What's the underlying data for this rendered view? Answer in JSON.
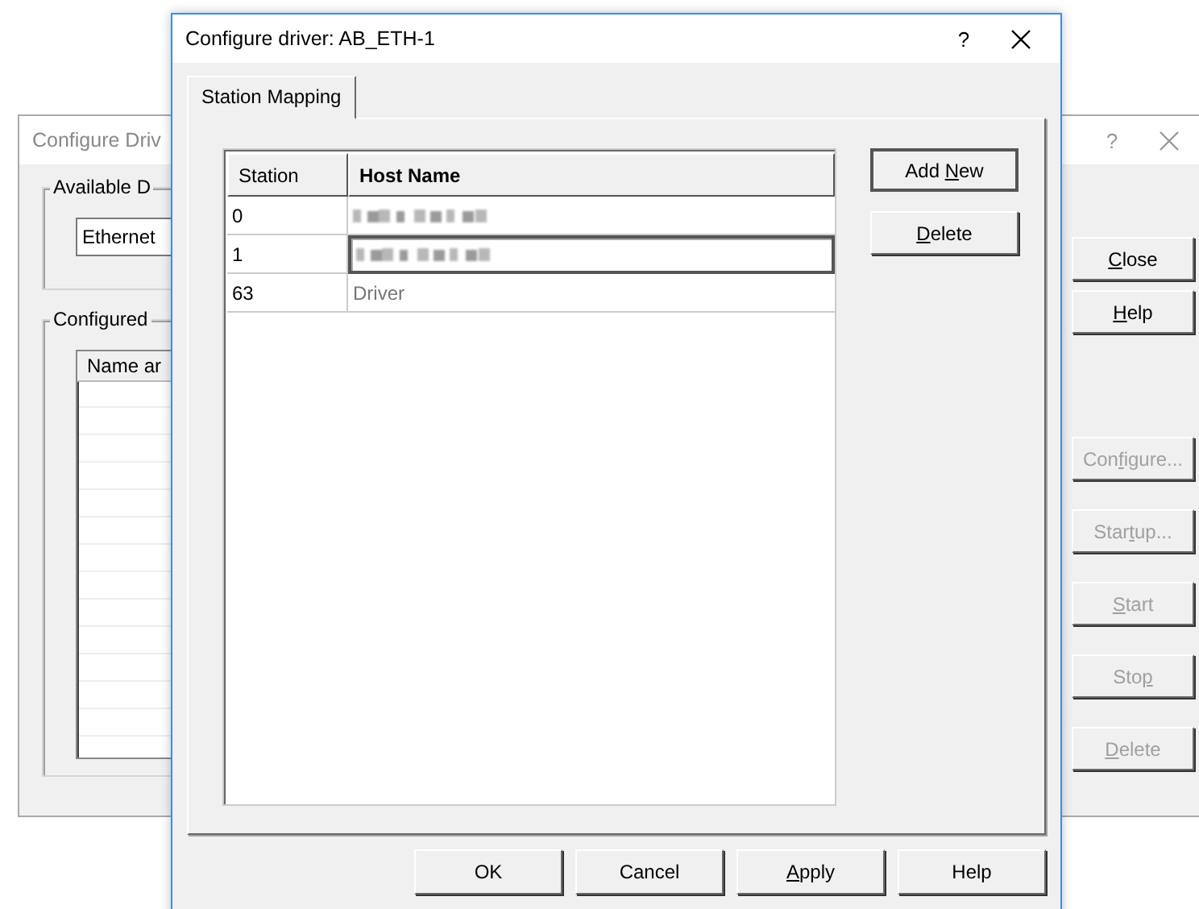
{
  "back_window": {
    "title": "Configure Driv",
    "active": false,
    "available_group": {
      "label": "Available D",
      "field_value": "Ethernet"
    },
    "configured_group": {
      "label": "Configured ",
      "column_header": "Name ar"
    },
    "buttons": [
      {
        "label": {
          "key": "C",
          "after": "lose"
        },
        "disabled": false
      },
      {
        "label": {
          "key": "H",
          "after": "elp"
        },
        "disabled": false
      },
      {
        "label": {
          "before": "Con",
          "key": "f",
          "after": "igure..."
        },
        "disabled": true
      },
      {
        "label": {
          "before": "Star",
          "key": "t",
          "after": "up..."
        },
        "disabled": true
      },
      {
        "label": {
          "key": "S",
          "after": "tart"
        },
        "disabled": true
      },
      {
        "label": {
          "before": "Sto",
          "key": "p"
        },
        "disabled": true
      },
      {
        "label": {
          "key": "D",
          "after": "elete"
        },
        "disabled": true
      }
    ],
    "help_glyph": "?"
  },
  "front_window": {
    "title": "Configure driver: AB_ETH-1",
    "active": true,
    "help_glyph": "?",
    "tabs": [
      {
        "label": "Station Mapping",
        "selected": true
      }
    ],
    "table": {
      "columns": [
        "Station",
        "Host Name"
      ],
      "rows": [
        {
          "station": "0",
          "host": {
            "kind": "blurred"
          },
          "selected": false
        },
        {
          "station": "1",
          "host": {
            "kind": "blurred"
          },
          "selected": true
        },
        {
          "station": "63",
          "host": {
            "kind": "text",
            "text": "Driver"
          },
          "selected": false
        }
      ]
    },
    "side_buttons": [
      {
        "label": {
          "before": "Add ",
          "key": "N",
          "after": "ew"
        },
        "default": true
      },
      {
        "label": {
          "key": "D",
          "after": "elete"
        },
        "default": false
      }
    ],
    "bottom_buttons": [
      {
        "label": {
          "before": "OK"
        }
      },
      {
        "label": {
          "before": "Cancel"
        }
      },
      {
        "label": {
          "key": "A",
          "after": "pply"
        }
      },
      {
        "label": {
          "before": "Help"
        }
      }
    ]
  }
}
